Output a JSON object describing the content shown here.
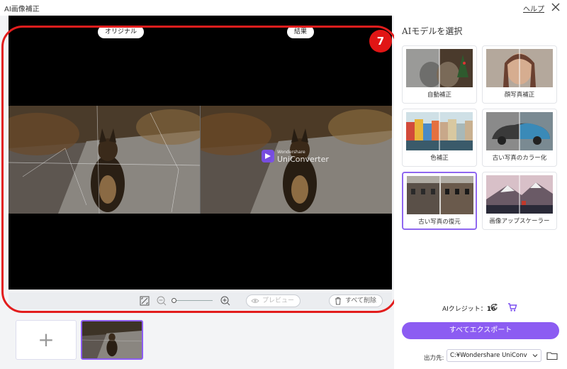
{
  "window": {
    "title": "AI画像補正",
    "help_label": "ヘルプ"
  },
  "preview": {
    "original_label": "オリジナル",
    "result_label": "結果",
    "watermark_small": "Wondershare",
    "watermark_big": "UniConverter",
    "step_badge": "7"
  },
  "toolbar": {
    "preview_label": "プレビュー",
    "delete_all_label": "すべて削除"
  },
  "right_panel": {
    "heading": "AIモデルを選択",
    "models": [
      {
        "label": "自動補正"
      },
      {
        "label": "顔写真補正"
      },
      {
        "label": "色補正"
      },
      {
        "label": "古い写真のカラー化"
      },
      {
        "label": "古い写真の復元",
        "selected": true
      },
      {
        "label": "画像アップスケーラー"
      }
    ],
    "credits_label": "AIクレジット：",
    "credits_value": "16",
    "export_label": "すべてエクスポート",
    "output_label": "出力先:",
    "output_path": "C:¥Wondershare UniConv"
  },
  "colors": {
    "accent": "#8c5cf2",
    "annotation_red": "#e21d1d"
  }
}
